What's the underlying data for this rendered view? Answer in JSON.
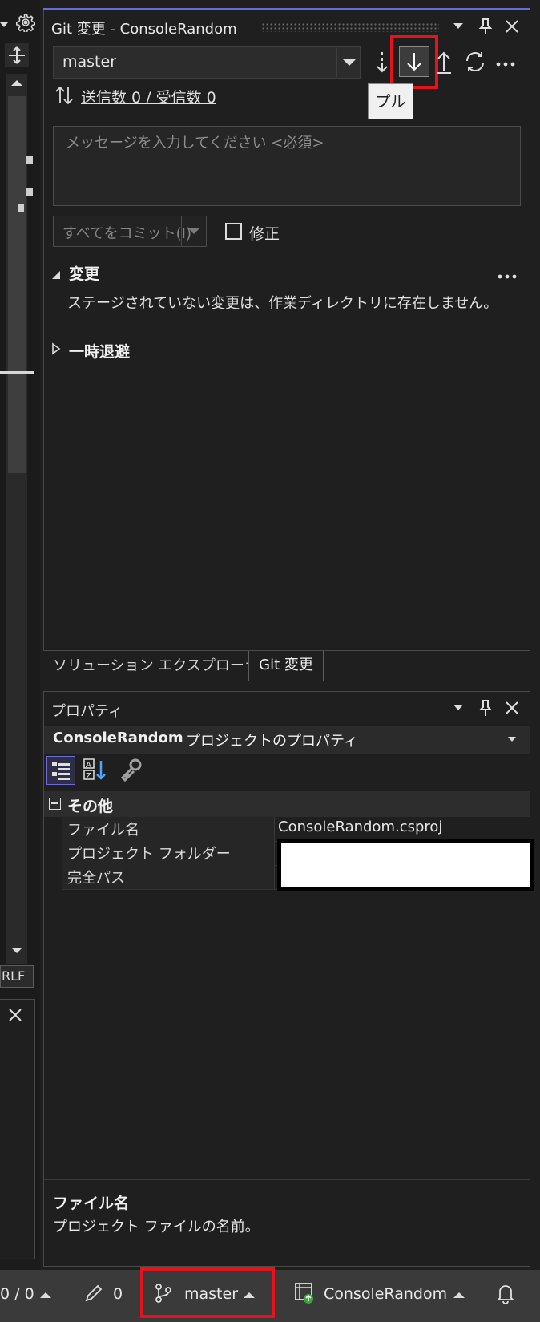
{
  "left_panel": {
    "crlf_label": "RLF"
  },
  "git_panel": {
    "title": "Git 変更 - ConsoleRandom",
    "branch": "master",
    "sync_status": "送信数 0 / 受信数 0",
    "message_placeholder": "メッセージを入力してください <必須>",
    "commit_all_label": "すべてをコミット(I)",
    "amend_label": "修正",
    "tooltip": "プル",
    "changes_section": {
      "title": "変更",
      "empty_text": "ステージされていない変更は、作業ディレクトリに存在しません。"
    },
    "stash_section": {
      "title": "一時退避"
    }
  },
  "tabs": [
    {
      "label": "ソリューション エクスプローラー",
      "active": false
    },
    {
      "label": "Git 変更",
      "active": true
    }
  ],
  "properties_panel": {
    "title": "プロパティ",
    "object_name": "ConsoleRandom",
    "object_type": "プロジェクトのプロパティ",
    "category": "その他",
    "rows": [
      {
        "name": "ファイル名",
        "value": "ConsoleRandom.csproj"
      },
      {
        "name": "プロジェクト フォルダー",
        "value": ""
      },
      {
        "name": "完全パス",
        "value": ""
      }
    ],
    "description_title": "ファイル名",
    "description_text": "プロジェクト ファイルの名前。"
  },
  "status_bar": {
    "push_pull": "0 / 0",
    "pending_changes": "0",
    "branch": "master",
    "repo": "ConsoleRandom"
  },
  "colors": {
    "highlight_red": "#e8121a",
    "panel_bg": "#1f1f1f",
    "accent_line": "#6b6bd6",
    "status_bar_bg": "#3a3a3a"
  },
  "icons": [
    "gear-icon",
    "move-icon",
    "pin-icon",
    "close-icon",
    "fetch-icon",
    "pull-icon",
    "push-icon",
    "sync-icon",
    "more-icon",
    "sort-icon",
    "categorized-icon",
    "alphabetical-icon",
    "property-pages-icon",
    "pencil-icon",
    "branch-icon",
    "repo-icon",
    "bell-icon"
  ]
}
